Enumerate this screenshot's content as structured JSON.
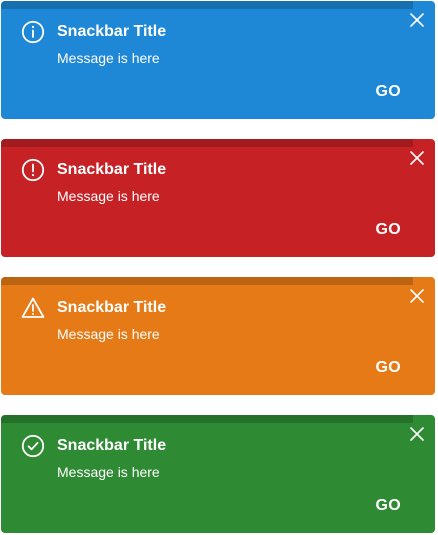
{
  "colors": {
    "info": "#1e88d6",
    "error": "#c62125",
    "warning": "#e57a16",
    "success": "#2f8a34"
  },
  "snackbars": [
    {
      "variant": "info",
      "icon": "info-circle-icon",
      "title": "Snackbar Title",
      "message": "Message is here",
      "action_label": "GO",
      "progress": 0.95
    },
    {
      "variant": "error",
      "icon": "exclamation-circle-icon",
      "title": "Snackbar Title",
      "message": "Message is here",
      "action_label": "GO",
      "progress": 0.95
    },
    {
      "variant": "warning",
      "icon": "warning-triangle-icon",
      "title": "Snackbar Title",
      "message": "Message is here",
      "action_label": "GO",
      "progress": 0.95
    },
    {
      "variant": "success",
      "icon": "check-circle-icon",
      "title": "Snackbar Title",
      "message": "Message is here",
      "action_label": "GO",
      "progress": 0.95
    }
  ]
}
